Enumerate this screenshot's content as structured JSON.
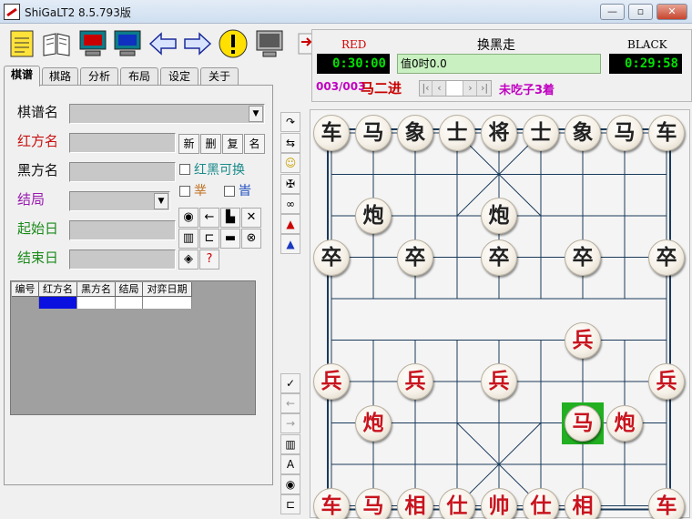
{
  "window": {
    "title": "ShiGaLT2 8.5.793版",
    "buttons": [
      "minimize",
      "restore",
      "close"
    ]
  },
  "toolbar": {
    "icons": [
      "notes-icon",
      "book-icon",
      "monitor-red-icon",
      "monitor-blue-icon",
      "arrow-left-icon",
      "arrow-right-icon",
      "warning-icon",
      "computer-icon",
      "swap-icon"
    ]
  },
  "status": {
    "red_label": "RED",
    "black_label": "BLACK",
    "turn": "换黑走",
    "red_clock": "0:30:00",
    "black_clock": "0:29:58",
    "eval": "值0时0.0",
    "move_counter": "003/003",
    "move_name": "马二进",
    "capture_info": "未吃子3着"
  },
  "tabs": [
    "棋谱",
    "棋路",
    "分析",
    "布局",
    "设定",
    "关于"
  ],
  "form": {
    "record_name": "棋谱名",
    "red_name": "红方名",
    "black_name": "黑方名",
    "result": "结局",
    "start_date": "起始日",
    "end_date": "结束日",
    "btn_new": "新",
    "btn_delete": "删",
    "btn_copy": "复",
    "btn_name": "名",
    "swap_label": "红黑可换",
    "chk2_label": "丵",
    "chk3_label": "旹"
  },
  "grid_headers": [
    "编号",
    "红方名",
    "黑方名",
    "结局",
    "对弈日期"
  ],
  "colors": {
    "red_piece": "#c8141e",
    "black_piece": "#222222",
    "clock_text": "#00e000",
    "highlight": "#22b022"
  },
  "board_pieces": [
    {
      "label": "车",
      "side": "black",
      "col": 0,
      "row": 0
    },
    {
      "label": "马",
      "side": "black",
      "col": 1,
      "row": 0
    },
    {
      "label": "象",
      "side": "black",
      "col": 2,
      "row": 0
    },
    {
      "label": "士",
      "side": "black",
      "col": 3,
      "row": 0
    },
    {
      "label": "将",
      "side": "black",
      "col": 4,
      "row": 0
    },
    {
      "label": "士",
      "side": "black",
      "col": 5,
      "row": 0
    },
    {
      "label": "象",
      "side": "black",
      "col": 6,
      "row": 0
    },
    {
      "label": "马",
      "side": "black",
      "col": 7,
      "row": 0
    },
    {
      "label": "车",
      "side": "black",
      "col": 8,
      "row": 0
    },
    {
      "label": "炮",
      "side": "black",
      "col": 1,
      "row": 2
    },
    {
      "label": "炮",
      "side": "black",
      "col": 4,
      "row": 2
    },
    {
      "label": "卒",
      "side": "black",
      "col": 0,
      "row": 3
    },
    {
      "label": "卒",
      "side": "black",
      "col": 2,
      "row": 3
    },
    {
      "label": "卒",
      "side": "black",
      "col": 4,
      "row": 3
    },
    {
      "label": "卒",
      "side": "black",
      "col": 6,
      "row": 3
    },
    {
      "label": "卒",
      "side": "black",
      "col": 8,
      "row": 3
    },
    {
      "label": "兵",
      "side": "red",
      "col": 6,
      "row": 5
    },
    {
      "label": "兵",
      "side": "red",
      "col": 0,
      "row": 6
    },
    {
      "label": "兵",
      "side": "red",
      "col": 2,
      "row": 6
    },
    {
      "label": "兵",
      "side": "red",
      "col": 4,
      "row": 6
    },
    {
      "label": "兵",
      "side": "red",
      "col": 8,
      "row": 6
    },
    {
      "label": "炮",
      "side": "red",
      "col": 1,
      "row": 7
    },
    {
      "label": "马",
      "side": "red",
      "col": 6,
      "row": 7,
      "highlight": true
    },
    {
      "label": "炮",
      "side": "red",
      "col": 7,
      "row": 7
    },
    {
      "label": "车",
      "side": "red",
      "col": 0,
      "row": 9
    },
    {
      "label": "马",
      "side": "red",
      "col": 1,
      "row": 9
    },
    {
      "label": "相",
      "side": "red",
      "col": 2,
      "row": 9
    },
    {
      "label": "仕",
      "side": "red",
      "col": 3,
      "row": 9
    },
    {
      "label": "帅",
      "side": "red",
      "col": 4,
      "row": 9
    },
    {
      "label": "仕",
      "side": "red",
      "col": 5,
      "row": 9
    },
    {
      "label": "相",
      "side": "red",
      "col": 6,
      "row": 9
    },
    {
      "label": "车",
      "side": "red",
      "col": 8,
      "row": 9
    }
  ]
}
